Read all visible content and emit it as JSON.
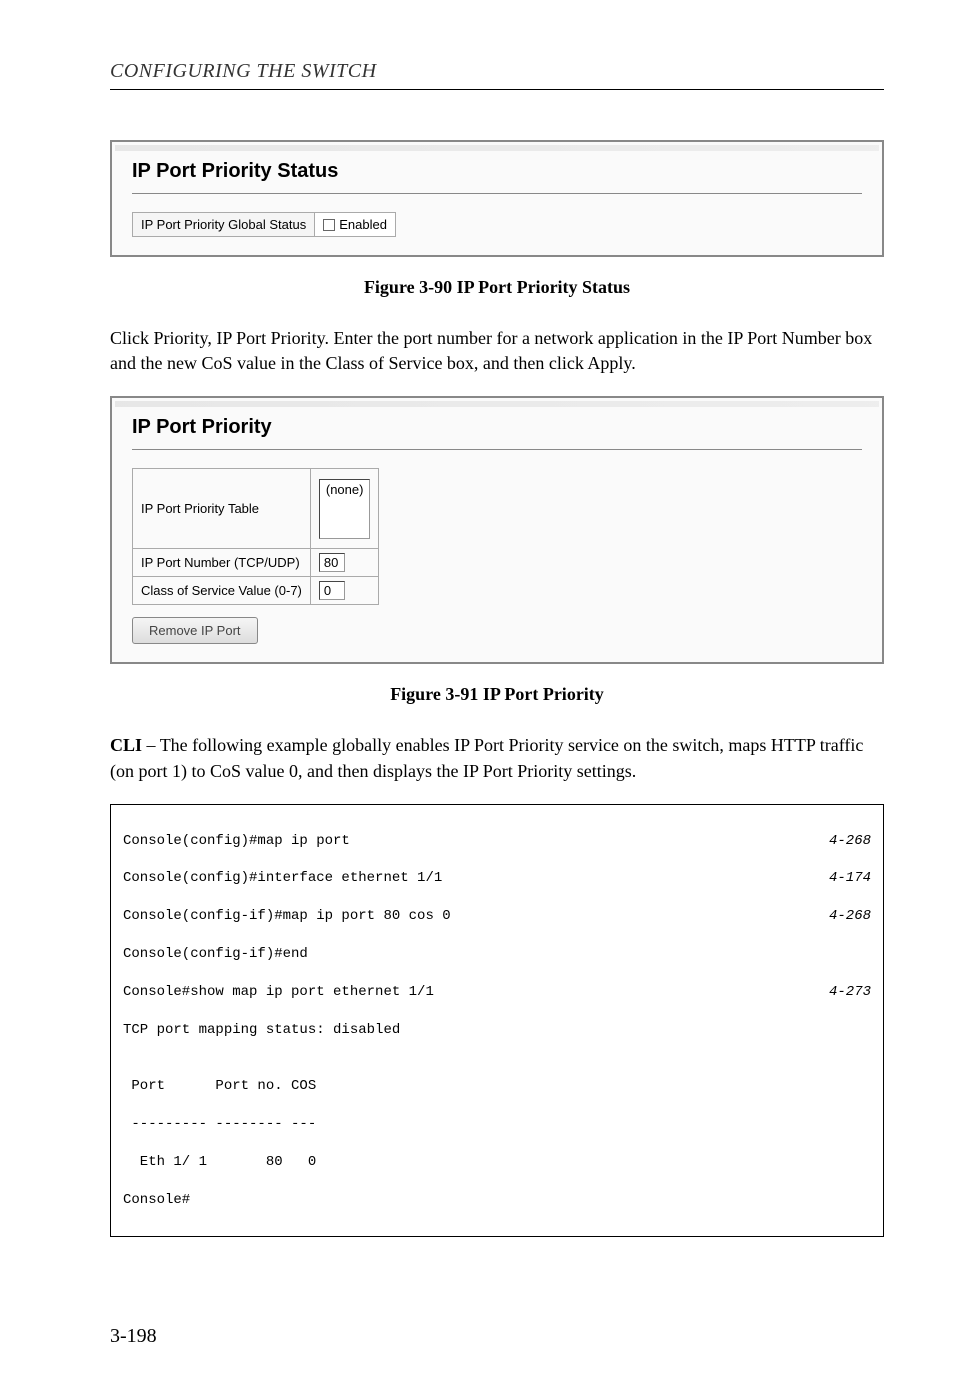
{
  "header": "CONFIGURING THE SWITCH",
  "panel1": {
    "title": "IP Port Priority Status",
    "row_label": "IP Port Priority Global Status",
    "row_value": "Enabled"
  },
  "fig1_caption": "Figure 3-90  IP Port Priority Status",
  "para1": "Click Priority, IP Port Priority. Enter the port number for a network application in the IP Port Number box and the new CoS value in the Class of Service box, and then click Apply.",
  "panel2": {
    "title": "IP Port Priority",
    "r1_label": "IP Port Priority Table",
    "r1_value": "(none)",
    "r2_label": "IP Port Number (TCP/UDP)",
    "r2_value": "80",
    "r3_label": "Class of Service Value (0-7)",
    "r3_value": "0",
    "button": "Remove IP Port"
  },
  "fig2_caption": "Figure 3-91  IP Port Priority",
  "para2_prefix": "CLI",
  "para2": " – The following example globally enables IP Port Priority service on the switch, maps HTTP traffic (on port 1) to CoS value 0, and then displays the IP Port Priority settings.",
  "code": {
    "l1": "Console(config)#map ip port",
    "l1r": "4-268",
    "l2": "Console(config)#interface ethernet 1/1",
    "l2r": "4-174",
    "l3": "Console(config-if)#map ip port 80 cos 0",
    "l3r": "4-268",
    "l4": "Console(config-if)#end",
    "l5": "Console#show map ip port ethernet 1/1",
    "l5r": "4-273",
    "l6": "TCP port mapping status: disabled",
    "l7": "",
    "l8": " Port      Port no. COS",
    "l9": " --------- -------- ---",
    "l10": "  Eth 1/ 1       80   0",
    "l11": "Console#"
  },
  "page_number": "3-198"
}
